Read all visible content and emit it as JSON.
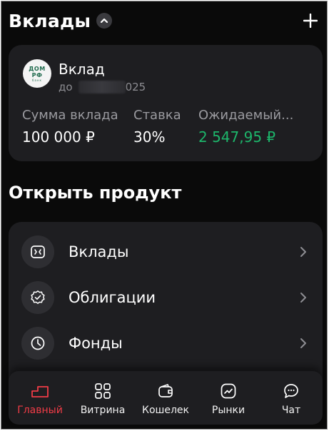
{
  "header": {
    "title": "Вклады",
    "collapse_icon": "chevron-up-icon",
    "add_icon": "plus-icon"
  },
  "deposit": {
    "bank_logo_line1": "ДОМ",
    "bank_logo_line2": "РФ",
    "bank_logo_line3": "банк",
    "name": "Вклад",
    "term_prefix": "до",
    "term_suffix": "025",
    "sum_label": "Сумма вклада",
    "sum_value": "100 000 ₽",
    "rate_label": "Ставка",
    "rate_value": "30%",
    "expected_label": "Ожидаемый...",
    "expected_value": "2 547,95 ₽"
  },
  "open_product": {
    "title": "Открыть продукт",
    "items": [
      {
        "label": "Вклады",
        "icon": "deposit-icon"
      },
      {
        "label": "Облигации",
        "icon": "bonds-badge-icon"
      },
      {
        "label": "Фонды",
        "icon": "clock-icon"
      }
    ]
  },
  "nav": {
    "items": [
      {
        "label": "Главный",
        "icon": "home-icon",
        "active": true
      },
      {
        "label": "Витрина",
        "icon": "grid-icon",
        "active": false
      },
      {
        "label": "Кошелек",
        "icon": "wallet-icon",
        "active": false
      },
      {
        "label": "Рынки",
        "icon": "chart-icon",
        "active": false
      },
      {
        "label": "Чат",
        "icon": "chat-icon",
        "active": false
      }
    ]
  },
  "colors": {
    "background": "#0a0a0a",
    "card": "#1e1e21",
    "accent_red": "#f13c47",
    "positive_green": "#1db66b",
    "muted_text": "#9a9a9f"
  }
}
